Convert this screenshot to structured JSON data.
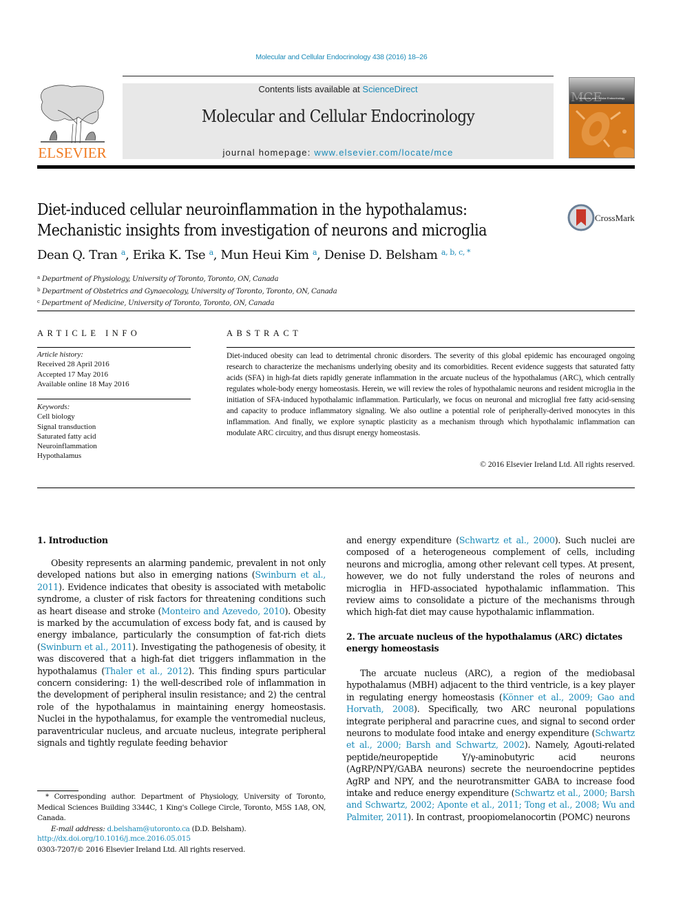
{
  "header": {
    "journal_citation": "Molecular and Cellular Endocrinology 438 (2016) 18–26",
    "contents_prefix": "Contents lists available at ",
    "contents_link": "ScienceDirect",
    "journal_title": "Molecular and Cellular Endocrinology",
    "homepage_prefix": "journal homepage: ",
    "homepage_link": "www.elsevier.com/locate/mce",
    "publisher_logo_text": "ELSEVIER",
    "cover": {
      "abbrev": "MCE",
      "subtitle": "Molecular and Cellular Endocrinology"
    },
    "crossmark_label": "CrossMark"
  },
  "colors": {
    "link": "#1a8ab8",
    "elsevier_orange": "#f07a1f",
    "banner_bg": "#e8e8e8",
    "cover_orange": "#d87b1e"
  },
  "article": {
    "title_line1": "Diet-induced cellular neuroinflammation in the hypothalamus:",
    "title_line2": "Mechanistic insights from investigation of neurons and microglia",
    "authors": [
      {
        "name": "Dean Q. Tran",
        "sup": "a"
      },
      {
        "name": "Erika K. Tse",
        "sup": "a"
      },
      {
        "name": "Mun Heui Kim",
        "sup": "a"
      },
      {
        "name": "Denise D. Belsham",
        "sup": "a, b, c, *"
      }
    ],
    "affiliations": [
      {
        "sup": "a",
        "text": "Department of Physiology, University of Toronto, Toronto, ON, Canada"
      },
      {
        "sup": "b",
        "text": "Department of Obstetrics and Gynaecology, University of Toronto, Toronto, ON, Canada"
      },
      {
        "sup": "c",
        "text": "Department of Medicine, University of Toronto, Toronto, ON, Canada"
      }
    ]
  },
  "article_info": {
    "heading": "ARTICLE INFO",
    "history_label": "Article history:",
    "history": [
      "Received 28 April 2016",
      "Accepted 17 May 2016",
      "Available online 18 May 2016"
    ],
    "keywords_label": "Keywords:",
    "keywords": [
      "Cell biology",
      "Signal transduction",
      "Saturated fatty acid",
      "Neuroinflammation",
      "Hypothalamus"
    ]
  },
  "abstract": {
    "heading": "ABSTRACT",
    "text": "Diet-induced obesity can lead to detrimental chronic disorders. The severity of this global epidemic has encouraged ongoing research to characterize the mechanisms underlying obesity and its comorbidities. Recent evidence suggests that saturated fatty acids (SFA) in high-fat diets rapidly generate inflammation in the arcuate nucleus of the hypothalamus (ARC), which centrally regulates whole-body energy homeostasis. Herein, we will review the roles of hypothalamic neurons and resident microglia in the initiation of SFA-induced hypothalamic inflammation. Particularly, we focus on neuronal and microglial free fatty acid-sensing and capacity to produce inflammatory signaling. We also outline a potential role of peripherally-derived monocytes in this inflammation. And finally, we explore synaptic plasticity as a mechanism through which hypothalamic inflammation can modulate ARC circuitry, and thus disrupt energy homeostasis.",
    "copyright": "© 2016 Elsevier Ireland Ltd. All rights reserved."
  },
  "body": {
    "section1_heading": "1.  Introduction",
    "s1_p1": [
      {
        "t": "Obesity represents an alarming pandemic, prevalent in not only developed nations but also in emerging nations ("
      },
      {
        "l": "Swinburn et al., 2011"
      },
      {
        "t": "). Evidence indicates that obesity is associated with metabolic syndrome, a cluster of risk factors for threatening conditions such as heart disease and stroke ("
      },
      {
        "l": "Monteiro and Azevedo, 2010"
      },
      {
        "t": "). Obesity is marked by the accumulation of excess body fat, and is caused by energy imbalance, particularly the consumption of fat-rich diets ("
      },
      {
        "l": "Swinburn et al., 2011"
      },
      {
        "t": "). Investigating the pathogenesis of obesity, it was discovered that a high-fat diet triggers inflammation in the hypothalamus ("
      },
      {
        "l": "Thaler et al., 2012"
      },
      {
        "t": "). This finding spurs particular concern considering: 1) the well-described role of inflammation in the development of peripheral insulin resistance; and 2) the central role of the hypothalamus in maintaining energy homeostasis. Nuclei in the hypothalamus, for example the ventromedial nucleus, paraventricular nucleus, and arcuate nucleus, integrate peripheral signals and tightly regulate feeding behavior"
      }
    ],
    "s1_p1_cont": [
      {
        "t": "and energy expenditure ("
      },
      {
        "l": "Schwartz et al., 2000"
      },
      {
        "t": "). Such nuclei are composed of a heterogeneous complement of cells, including neurons and microglia, among other relevant cell types. At present, however, we do not fully understand the roles of neurons and microglia in HFD-associated hypothalamic inflammation. This review aims to consolidate a picture of the mechanisms through which high-fat diet may cause hypothalamic inflammation."
      }
    ],
    "section2_heading": "2.  The arcuate nucleus of the hypothalamus (ARC) dictates energy homeostasis",
    "s2_p1": [
      {
        "t": "The arcuate nucleus (ARC), a region of the mediobasal hypothalamus (MBH) adjacent to the third ventricle, is a key player in regulating energy homeostasis ("
      },
      {
        "l": "Könner et al., 2009; Gao and Horvath, 2008"
      },
      {
        "t": "). Specifically, two ARC neuronal populations integrate peripheral and paracrine cues, and signal to second order neurons to modulate food intake and energy expenditure ("
      },
      {
        "l": "Schwartz et al., 2000; Barsh and Schwartz, 2002"
      },
      {
        "t": "). Namely, Agouti-related peptide/neuropeptide Y/γ-aminobutyric acid neurons (AgRP/NPY/GABA neurons) secrete the neuroendocrine peptides AgRP and NPY, and the neurotransmitter GABA to increase food intake and reduce energy expenditure ("
      },
      {
        "l": "Schwartz et al., 2000; Barsh and Schwartz, 2002; Aponte et al., 2011; Tong et al., 2008; Wu and Palmiter, 2011"
      },
      {
        "t": "). In contrast, proopiomelanocortin (POMC) neurons"
      }
    ]
  },
  "footnotes": {
    "corresponding": "* Corresponding author. Department of Physiology, University of Toronto, Medical Sciences Building 3344C, 1 King's College Circle, Toronto, M5S 1A8, ON, Canada.",
    "email_label": "E-mail address: ",
    "email": "d.belsham@utoronto.ca",
    "email_suffix": " (D.D. Belsham).",
    "doi": "http://dx.doi.org/10.1016/j.mce.2016.05.015",
    "issn_line": "0303-7207/© 2016 Elsevier Ireland Ltd. All rights reserved."
  }
}
